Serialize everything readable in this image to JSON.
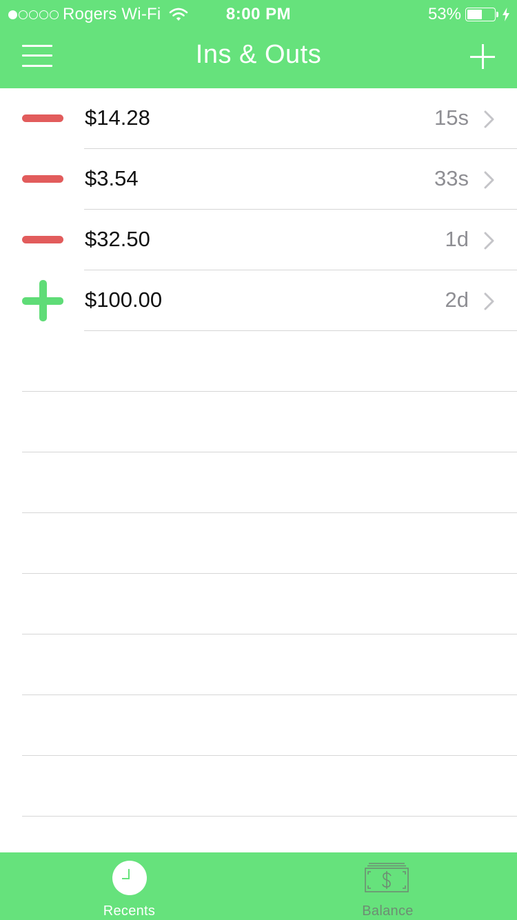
{
  "colors": {
    "brand": "#66e27c",
    "expense": "#e25c5c",
    "income": "#5fdc77",
    "muted_text": "#8e8e93",
    "tab_inactive": "#6d8d73"
  },
  "status_bar": {
    "signal_bars_filled": 1,
    "signal_bars_total": 5,
    "carrier": "Rogers Wi-Fi",
    "time": "8:00 PM",
    "battery_percent": "53%",
    "battery_level": 0.53,
    "charging": true
  },
  "header": {
    "title": "Ins & Outs",
    "menu_icon": "hamburger-menu-icon",
    "add_icon": "plus-icon"
  },
  "transactions": [
    {
      "type": "out",
      "amount": "$14.28",
      "age": "15s"
    },
    {
      "type": "out",
      "amount": "$3.54",
      "age": "33s"
    },
    {
      "type": "out",
      "amount": "$32.50",
      "age": "1d"
    },
    {
      "type": "in",
      "amount": "$100.00",
      "age": "2d"
    }
  ],
  "tabs": [
    {
      "id": "recents",
      "label": "Recents",
      "icon": "clock-icon",
      "active": true
    },
    {
      "id": "balance",
      "label": "Balance",
      "icon": "money-bill-icon",
      "active": false
    }
  ]
}
